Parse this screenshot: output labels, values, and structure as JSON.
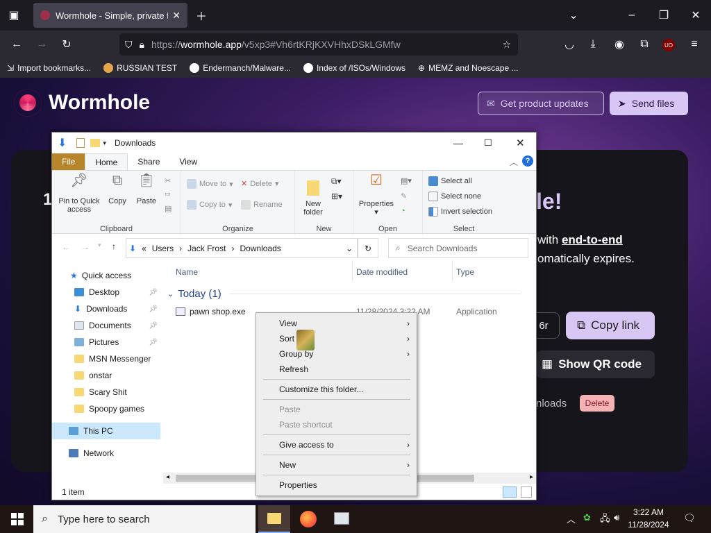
{
  "browser": {
    "tab_title": "Wormhole - Simple, private file",
    "url_prefix": "https://",
    "url_host": "wormhole.app",
    "url_path": "/v5xp3#Vh6rtKRjKXVHhxDSkLGMfw",
    "bookmarks": [
      {
        "label": "Import bookmarks...",
        "icon": "import-icon"
      },
      {
        "label": "RUSSIAN TEST",
        "icon": "globe-icon"
      },
      {
        "label": "Endermanch/Malware...",
        "icon": "google-icon"
      },
      {
        "label": "Index of /ISOs/Windows",
        "icon": "google-icon"
      },
      {
        "label": "MEMZ and Noescape ...",
        "icon": "globe-icon"
      }
    ]
  },
  "wormhole": {
    "logo_text": "Wormhole",
    "get_updates": "Get product updates",
    "send_files": "Send files",
    "heading_fragment": "le!",
    "desc_line1_a": "with ",
    "desc_line1_b": "end-to-end",
    "desc_line2": "omatically expires.",
    "link_fragment": "6r",
    "copy_link": "Copy link",
    "show_qr": "Show QR code",
    "downloads_fragment": "nloads",
    "delete": "Delete",
    "partial_one": "1"
  },
  "explorer": {
    "title": "Downloads",
    "tabs": [
      "File",
      "Home",
      "Share",
      "View"
    ],
    "ribbon": {
      "pin": "Pin to Quick access",
      "copy": "Copy",
      "paste": "Paste",
      "clipboard": "Clipboard",
      "move_to": "Move to",
      "copy_to": "Copy to",
      "delete": "Delete",
      "rename": "Rename",
      "organize": "Organize",
      "new_folder": "New folder",
      "new": "New",
      "properties": "Properties",
      "open": "Open",
      "select_all": "Select all",
      "select_none": "Select none",
      "invert_selection": "Invert selection",
      "select": "Select"
    },
    "breadcrumb": [
      "Users",
      "Jack Frost",
      "Downloads"
    ],
    "search_placeholder": "Search Downloads",
    "nav": {
      "quick_access": "Quick access",
      "items": [
        "Desktop",
        "Downloads",
        "Documents",
        "Pictures",
        "MSN Messenger",
        "onstar",
        "Scary Shit",
        "Spoopy games"
      ],
      "this_pc": "This PC",
      "network": "Network"
    },
    "columns": [
      "Name",
      "Date modified",
      "Type"
    ],
    "group_label": "Today (1)",
    "file": {
      "name": "pawn shop.exe",
      "date": "11/28/2024 3:22 AM",
      "type": "Application"
    },
    "status": "1 item"
  },
  "context_menu": {
    "items": [
      "View",
      "Sort by",
      "Group by",
      "Refresh",
      "Customize this folder...",
      "Paste",
      "Paste shortcut",
      "Give access to",
      "New",
      "Properties"
    ]
  },
  "taskbar": {
    "search_placeholder": "Type here to search",
    "time": "3:22 AM",
    "date": "11/28/2024"
  }
}
